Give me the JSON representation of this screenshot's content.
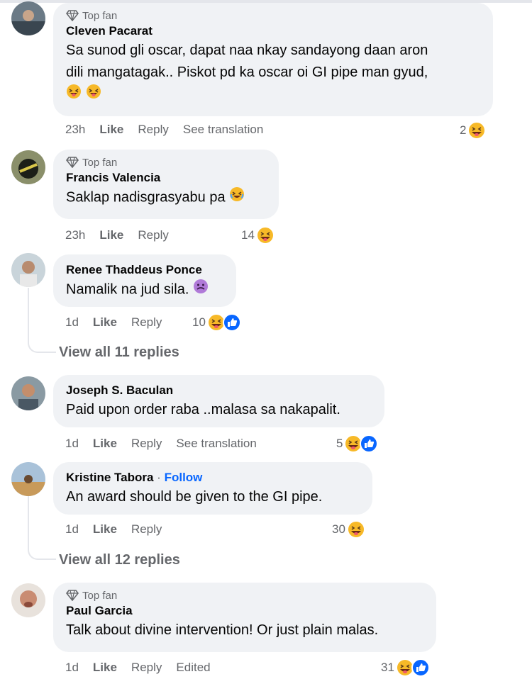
{
  "comments": [
    {
      "badge": "Top fan",
      "name": "Cleven Pacarat",
      "text_line1": "Sa sunod gli oscar, dapat naa nkay sandayong daan aron",
      "text_line2": "dili mangatagak.. Piskot pd ka oscar oi GI pipe man gyud,",
      "emoji_line": "laughing-tongue-emoji x2",
      "time": "23h",
      "like": "Like",
      "reply": "Reply",
      "extra": "See translation",
      "reaction_count": "2",
      "reactions": [
        "haha-icon"
      ]
    },
    {
      "badge": "Top fan",
      "name": "Francis Valencia",
      "text": "Saklap nadisgrasyabu pa",
      "time": "23h",
      "like": "Like",
      "reply": "Reply",
      "reaction_count": "14",
      "reactions": [
        "haha-icon"
      ]
    },
    {
      "name": "Renee Thaddeus Ponce",
      "text": "Namalik na jud sila.",
      "time": "1d",
      "like": "Like",
      "reply": "Reply",
      "reaction_count": "10",
      "reactions": [
        "haha-icon",
        "like-icon"
      ],
      "view_replies": "View all 11 replies"
    },
    {
      "name": "Joseph S. Baculan",
      "text": "Paid upon order raba ..malasa sa nakapalit.",
      "time": "1d",
      "like": "Like",
      "reply": "Reply",
      "extra": "See translation",
      "reaction_count": "5",
      "reactions": [
        "haha-icon",
        "like-icon"
      ]
    },
    {
      "name": "Kristine Tabora",
      "separator": "·",
      "follow": "Follow",
      "text": "An award should be given to the GI pipe.",
      "time": "1d",
      "like": "Like",
      "reply": "Reply",
      "reaction_count": "30",
      "reactions": [
        "haha-icon"
      ],
      "view_replies": "View all 12 replies"
    },
    {
      "badge": "Top fan",
      "name": "Paul Garcia",
      "text": "Talk about divine intervention! Or just plain malas.",
      "time": "1d",
      "like": "Like",
      "reply": "Reply",
      "extra": "Edited",
      "reaction_count": "31",
      "reactions": [
        "haha-icon",
        "like-icon"
      ]
    }
  ],
  "colors": {
    "bubble": "#f0f2f5",
    "muted": "#65676b",
    "link": "#0866ff",
    "like_blue": "#0866ff",
    "haha_yellow": "#f7b928"
  }
}
